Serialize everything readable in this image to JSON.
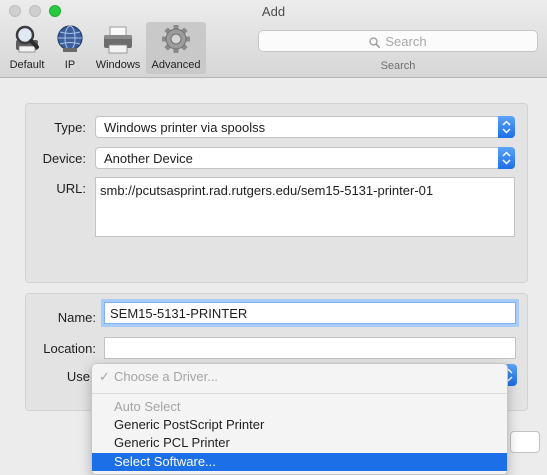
{
  "window": {
    "title": "Add"
  },
  "toolbar": {
    "buttons": [
      {
        "label": "Default",
        "icon": "magnifier-printer-icon"
      },
      {
        "label": "IP",
        "icon": "globe-icon"
      },
      {
        "label": "Windows",
        "icon": "printer-icon"
      },
      {
        "label": "Advanced",
        "icon": "gear-icon",
        "active": true
      }
    ],
    "search": {
      "placeholder": "Search",
      "label": "Search"
    }
  },
  "form": {
    "type": {
      "label": "Type:",
      "value": "Windows printer via spoolss"
    },
    "device": {
      "label": "Device:",
      "value": "Another Device"
    },
    "url": {
      "label": "URL:",
      "value": "smb://pcutsasprint.rad.rutgers.edu/sem15-5131-printer-01"
    },
    "name": {
      "label": "Name:",
      "value": "SEM15-5131-PRINTER"
    },
    "location": {
      "label": "Location:",
      "value": ""
    },
    "use": {
      "label": "Use"
    }
  },
  "driver_menu": {
    "header": "Choose a Driver...",
    "items": [
      {
        "label": "Auto Select",
        "state": "disabled"
      },
      {
        "label": "Generic PostScript Printer",
        "state": "normal"
      },
      {
        "label": "Generic PCL Printer",
        "state": "normal"
      },
      {
        "label": "Select Software...",
        "state": "highlighted"
      }
    ]
  },
  "colors": {
    "accent": "#1c6fe7",
    "zoom_button": "#27c93f"
  }
}
